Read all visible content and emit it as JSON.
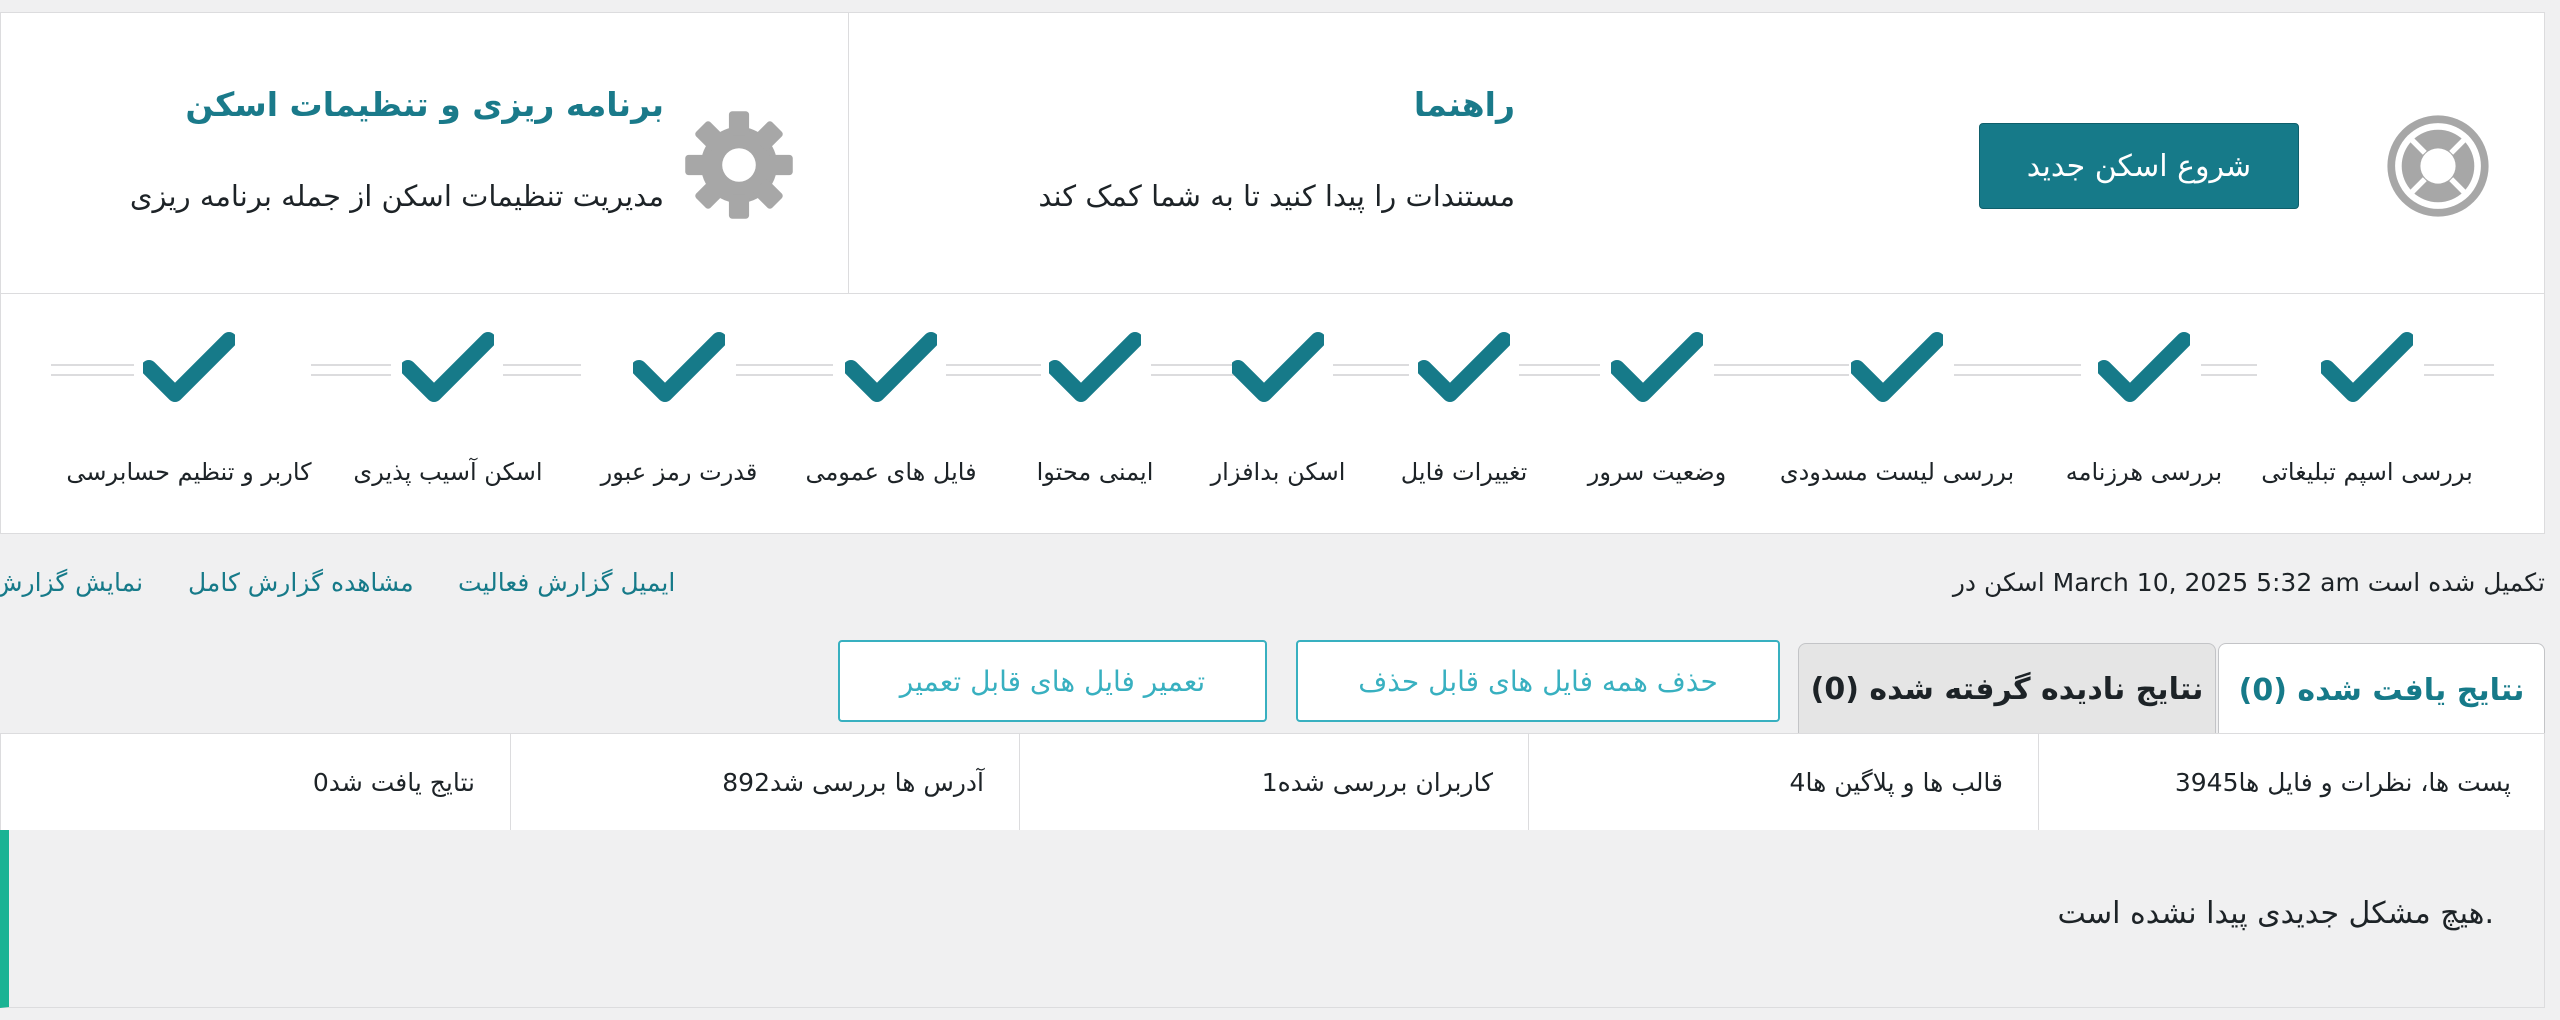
{
  "header": {
    "start_button": "شروع اسکن جدید",
    "help": {
      "title": "راهنما",
      "description": "مستندات را پیدا کنید تا به شما کمک کند"
    },
    "schedule": {
      "title": "برنامه ریزی و تنظیمات اسکن",
      "description": "مدیریت تنظیمات اسکن از جمله برنامه ریزی"
    }
  },
  "steps": [
    {
      "label": "بررسی اسپم تبلیغاتی",
      "icon": "checkmark-icon",
      "status": "complete"
    },
    {
      "label": "بررسی هرزنامه",
      "icon": "checkmark-icon",
      "status": "complete"
    },
    {
      "label": "بررسی لیست مسدودی",
      "icon": "checkmark-icon",
      "status": "complete"
    },
    {
      "label": "وضعیت سرور",
      "icon": "checkmark-icon",
      "status": "complete"
    },
    {
      "label": "تغییرات فایل",
      "icon": "checkmark-icon",
      "status": "complete"
    },
    {
      "label": "اسکن بدافزار",
      "icon": "checkmark-icon",
      "status": "complete"
    },
    {
      "label": "ایمنی محتوا",
      "icon": "checkmark-icon",
      "status": "complete"
    },
    {
      "label": "فایل های عمومی",
      "icon": "checkmark-icon",
      "status": "complete"
    },
    {
      "label": "قدرت رمز عبور",
      "icon": "checkmark-icon",
      "status": "complete"
    },
    {
      "label": "اسکن آسیب پذیری",
      "icon": "checkmark-icon",
      "status": "complete"
    },
    {
      "label": "کاربر و تنظیم حسابرسی",
      "icon": "checkmark-icon",
      "status": "complete"
    }
  ],
  "status": {
    "text": "اسکن در March 10, 2025 5:32 am تکمیل شده است"
  },
  "links": {
    "email_log": "ایمیل گزارش فعالیت",
    "full_log": "مشاهده گزارش کامل",
    "show_log": "نمایش گزارش"
  },
  "tabs": {
    "found": "نتایج یافت شده (0)",
    "ignored": "نتایج نادیده گرفته شده (0)"
  },
  "actions": {
    "delete_all": "حذف همه فایل های قابل حذف",
    "repair_all": "تعمیر فایل های قابل تعمیر"
  },
  "stats": [
    "پست ها، نظرات و فایل ها3945",
    "قالب ها و پلاگین ها4",
    "کاربران بررسی شده1",
    "آدرس ها بررسی شد892",
    "نتایج یافت شد0"
  ],
  "results": {
    "message": "هیچ مشکل جدیدی پیدا نشده است."
  },
  "colors": {
    "accent": "#167a89",
    "accent_light": "#38b0c0",
    "success_bar": "#1ab394",
    "icon_gray": "#a7a7a7"
  }
}
